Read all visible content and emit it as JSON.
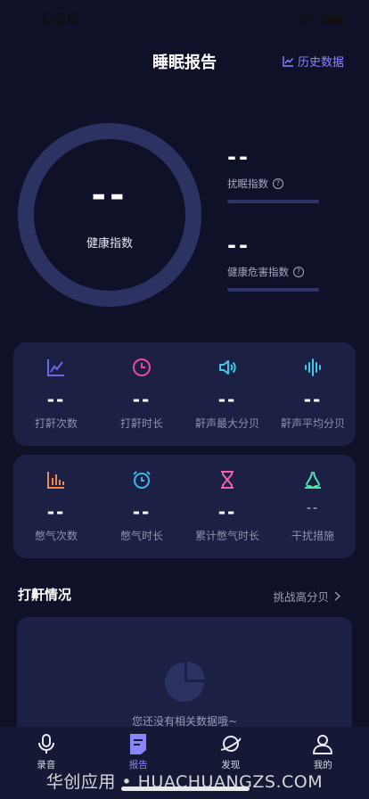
{
  "status_bar": {
    "time": "1:26"
  },
  "header": {
    "title": "睡眠报告",
    "history_label": "历史数据"
  },
  "health": {
    "value": "--",
    "label": "健康指数"
  },
  "metrics": [
    {
      "value": "--",
      "label": "扰眠指数"
    },
    {
      "value": "--",
      "label": "健康危害指数"
    }
  ],
  "snore_stats": [
    {
      "icon": "line-chart-icon",
      "value": "--",
      "label": "打鼾次数",
      "color": "#6b67e8"
    },
    {
      "icon": "clock-icon",
      "value": "--",
      "label": "打鼾时长",
      "color": "#e94aa6"
    },
    {
      "icon": "speaker-icon",
      "value": "--",
      "label": "鼾声最大分贝",
      "color": "#3fc9e6"
    },
    {
      "icon": "sound-wave-icon",
      "value": "--",
      "label": "鼾声平均分贝",
      "color": "#3fc9e6"
    }
  ],
  "breath_stats": [
    {
      "icon": "bar-chart-icon",
      "value": "--",
      "label": "憋气次数",
      "color": "#f08a4b"
    },
    {
      "icon": "alarm-clock-icon",
      "value": "--",
      "label": "憋气时长",
      "color": "#3fb7e6"
    },
    {
      "icon": "hourglass-icon",
      "value": "--",
      "label": "累计憋气时长",
      "color": "#f05fb0"
    },
    {
      "icon": "nose-icon",
      "value": "--",
      "label": "干扰措施",
      "color": "#4fe0b0"
    }
  ],
  "section": {
    "title": "打鼾情况",
    "link_label": "挑战高分贝"
  },
  "empty": {
    "text": "您还没有相关数据哦~"
  },
  "tabs": [
    {
      "icon": "microphone-icon",
      "label": "录音"
    },
    {
      "icon": "report-icon",
      "label": "报告"
    },
    {
      "icon": "planet-icon",
      "label": "发现"
    },
    {
      "icon": "user-icon",
      "label": "我的"
    }
  ],
  "watermark": "华创应用 • HUACHUANGZS.COM",
  "colors": {
    "background": "#0f1129",
    "card": "#1b2044",
    "accent": "#8a86ff",
    "ring": "#2c3262"
  }
}
